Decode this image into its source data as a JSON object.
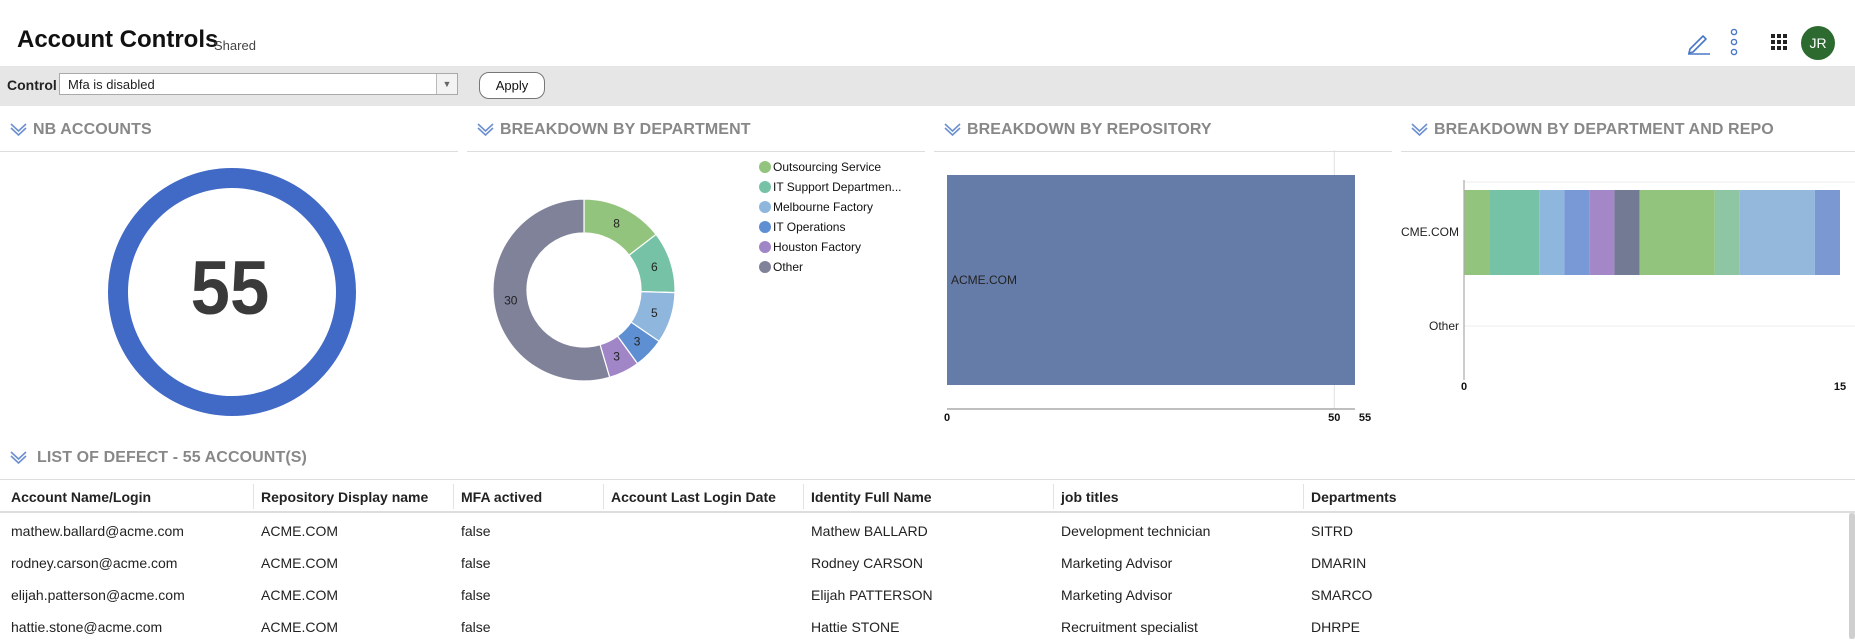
{
  "header": {
    "title": "Account Controls",
    "shared_label": "Shared",
    "avatar_initials": "JR"
  },
  "filter": {
    "label": "Control",
    "selected": "Mfa is disabled",
    "apply_label": "Apply"
  },
  "panels": {
    "nb_accounts": {
      "title": "NB ACCOUNTS",
      "value": "55",
      "ring_color": "#4169c6"
    },
    "department": {
      "title": "BREAKDOWN BY DEPARTMENT"
    },
    "repository": {
      "title": "BREAKDOWN BY REPOSITORY"
    },
    "dept_repo": {
      "title": "BREAKDOWN BY DEPARTMENT AND REPO"
    }
  },
  "chart_data": [
    {
      "type": "pie",
      "variant": "donut",
      "categories": [
        "Outsourcing Service",
        "IT Support Departmen...",
        "Melbourne Factory",
        "IT Operations",
        "Houston Factory",
        "Other"
      ],
      "values": [
        8,
        6,
        5,
        3,
        3,
        30
      ],
      "colors": [
        "#93c47d",
        "#76c2a6",
        "#8fb6dd",
        "#5e8fd2",
        "#a085c7",
        "#7f8299"
      ],
      "legend_position": "right"
    },
    {
      "type": "bar",
      "orientation": "horizontal",
      "categories": [
        "ACME.COM"
      ],
      "values": [
        55
      ],
      "xlim": [
        0,
        55
      ],
      "xticks": [
        "0",
        "50",
        "55"
      ],
      "color": "#667ca8"
    },
    {
      "type": "bar",
      "orientation": "horizontal",
      "stacked": true,
      "categories": [
        "ACME.COM",
        "Other"
      ],
      "visible_category_labels": [
        "CME.COM",
        "Other"
      ],
      "xlim": [
        0,
        15
      ],
      "xticks": [
        "0",
        "15"
      ],
      "segments": [
        {
          "value": 1,
          "color": "#93c47d"
        },
        {
          "value": 2,
          "color": "#76c2a6"
        },
        {
          "value": 1,
          "color": "#8fb6dd"
        },
        {
          "value": 1,
          "color": "#7898d6"
        },
        {
          "value": 1,
          "color": "#a387c7"
        },
        {
          "value": 1,
          "color": "#737a93"
        },
        {
          "value": 3,
          "color": "#93c47d"
        },
        {
          "value": 1,
          "color": "#8ec5a2"
        },
        {
          "value": 3,
          "color": "#93b8dc"
        },
        {
          "value": 1,
          "color": "#7b98d3"
        }
      ]
    }
  ],
  "list": {
    "title": "LIST OF DEFECT  - 55 ACCOUNT(S)",
    "columns": [
      "Account Name/Login",
      "Repository Display name",
      "MFA actived",
      "Account Last Login Date",
      "Identity Full Name",
      "job titles",
      "Departments"
    ],
    "rows": [
      [
        "mathew.ballard@acme.com",
        "ACME.COM",
        "false",
        "",
        "Mathew BALLARD",
        "Development technician",
        "SITRD"
      ],
      [
        "rodney.carson@acme.com",
        "ACME.COM",
        "false",
        "",
        "Rodney CARSON",
        "Marketing Advisor",
        "DMARIN"
      ],
      [
        "elijah.patterson@acme.com",
        "ACME.COM",
        "false",
        "",
        "Elijah PATTERSON",
        "Marketing Advisor",
        "SMARCO"
      ],
      [
        "hattie.stone@acme.com",
        "ACME.COM",
        "false",
        "",
        "Hattie STONE",
        "Recruitment specialist",
        "DHRPE"
      ]
    ]
  }
}
